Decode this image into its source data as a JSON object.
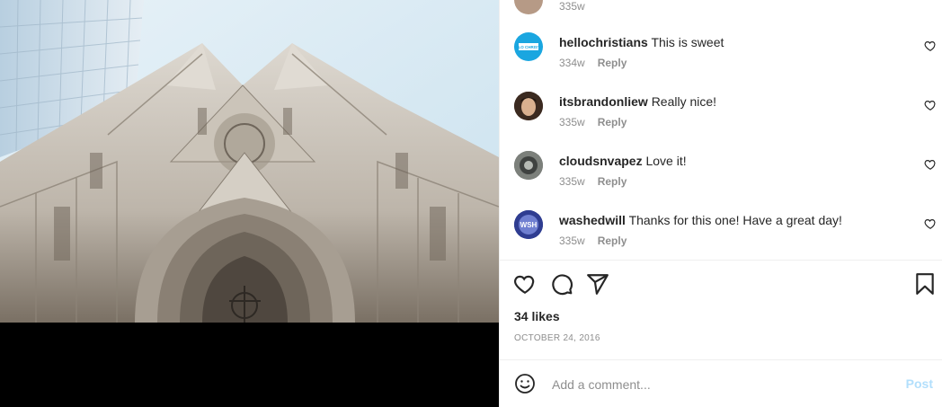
{
  "comments": [
    {
      "user": "",
      "text": "",
      "time": "335w",
      "reply": ""
    },
    {
      "user": "hellochristians",
      "text": "This is sweet",
      "time": "334w",
      "reply": "Reply",
      "avatar_text": "HELLO CHRISTIAN"
    },
    {
      "user": "itsbrandonliew",
      "text": "Really nice!",
      "time": "335w",
      "reply": "Reply"
    },
    {
      "user": "cloudsnvapez",
      "text": "Love it!",
      "time": "335w",
      "reply": "Reply"
    },
    {
      "user": "washedwill",
      "text": "Thanks for this one! Have a great day!",
      "time": "335w",
      "reply": "Reply",
      "avatar_text": "WSH"
    }
  ],
  "post": {
    "likes": "34 likes",
    "date": "OCTOBER 24, 2016"
  },
  "add_comment": {
    "placeholder": "Add a comment...",
    "post_label": "Post"
  },
  "icons": [
    "heart-icon",
    "comment-icon",
    "share-icon",
    "bookmark-icon",
    "emoji-icon"
  ],
  "colors": {
    "post_disabled": "#b2dffc",
    "muted": "#8e8e8e",
    "avatar_blue": "#1aa6e0"
  }
}
